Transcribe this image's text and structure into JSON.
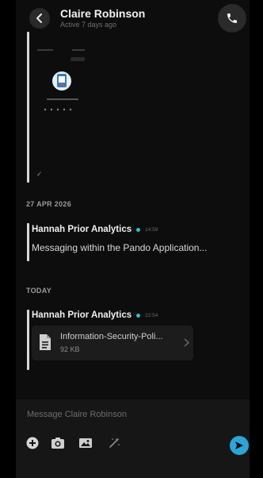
{
  "header": {
    "title": "Claire Robinson",
    "status": "Active 7 days ago",
    "back_icon": "chevron-left-icon",
    "call_icon": "phone-icon"
  },
  "thread": {
    "sent_tick": "✓",
    "groups": [
      {
        "date_label": "27 APR 2026",
        "sender": "Hannah Prior Analytics",
        "time": "14:59",
        "text": "Messaging within the Pando Application..."
      },
      {
        "date_label": "TODAY",
        "sender": "Hannah Prior Analytics",
        "time": "22:54",
        "attachment": {
          "name": "Information-Security-Poli...",
          "size": "92 KB",
          "icon": "document-icon"
        }
      }
    ]
  },
  "composer": {
    "placeholder": "Message Claire Robinson",
    "tools": [
      "plus-icon",
      "camera-icon",
      "image-icon",
      "sparkle-icon"
    ],
    "send_icon": "send-icon"
  },
  "colors": {
    "accent": "#26c4c8",
    "send": "#2aa6d8",
    "background": "#000000"
  }
}
